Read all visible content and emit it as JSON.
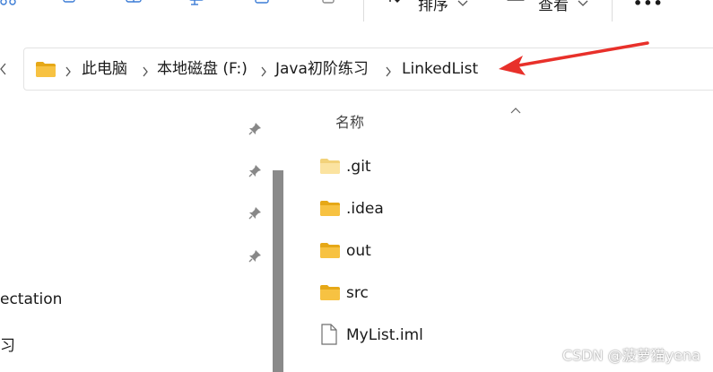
{
  "toolbar": {
    "items": [
      {
        "icon": "share-icon"
      },
      {
        "icon": "copy-icon"
      },
      {
        "icon": "paste-icon"
      },
      {
        "icon": "rename-icon"
      },
      {
        "icon": "share-arrow-icon"
      },
      {
        "icon": "delete-icon"
      }
    ],
    "sort_label": "排序",
    "view_label": "查看",
    "more_label": "•••"
  },
  "address_bar": {
    "separator": "›",
    "breadcrumbs": [
      "此电脑",
      "本地磁盘 (F:)",
      "Java初阶练习",
      "LinkedList"
    ]
  },
  "annotation": {
    "color": "#e8302a"
  },
  "nav": {
    "items": [
      {
        "label": "ectation"
      },
      {
        "label": "习"
      }
    ]
  },
  "file_list": {
    "column_header": "名称",
    "files": [
      {
        "name": ".git",
        "icon": "folder-icon",
        "type": "folder-light"
      },
      {
        "name": ".idea",
        "icon": "folder-icon",
        "type": "folder"
      },
      {
        "name": "out",
        "icon": "folder-icon",
        "type": "folder"
      },
      {
        "name": "src",
        "icon": "folder-icon",
        "type": "folder"
      },
      {
        "name": "MyList.iml",
        "icon": "document-icon",
        "type": "file"
      }
    ]
  },
  "watermark": {
    "text": "CSDN @菠萝猫yena"
  },
  "colors": {
    "folder_fill": "#f7c242",
    "folder_back": "#e6a817",
    "folder_light": "#fbe3a0"
  }
}
